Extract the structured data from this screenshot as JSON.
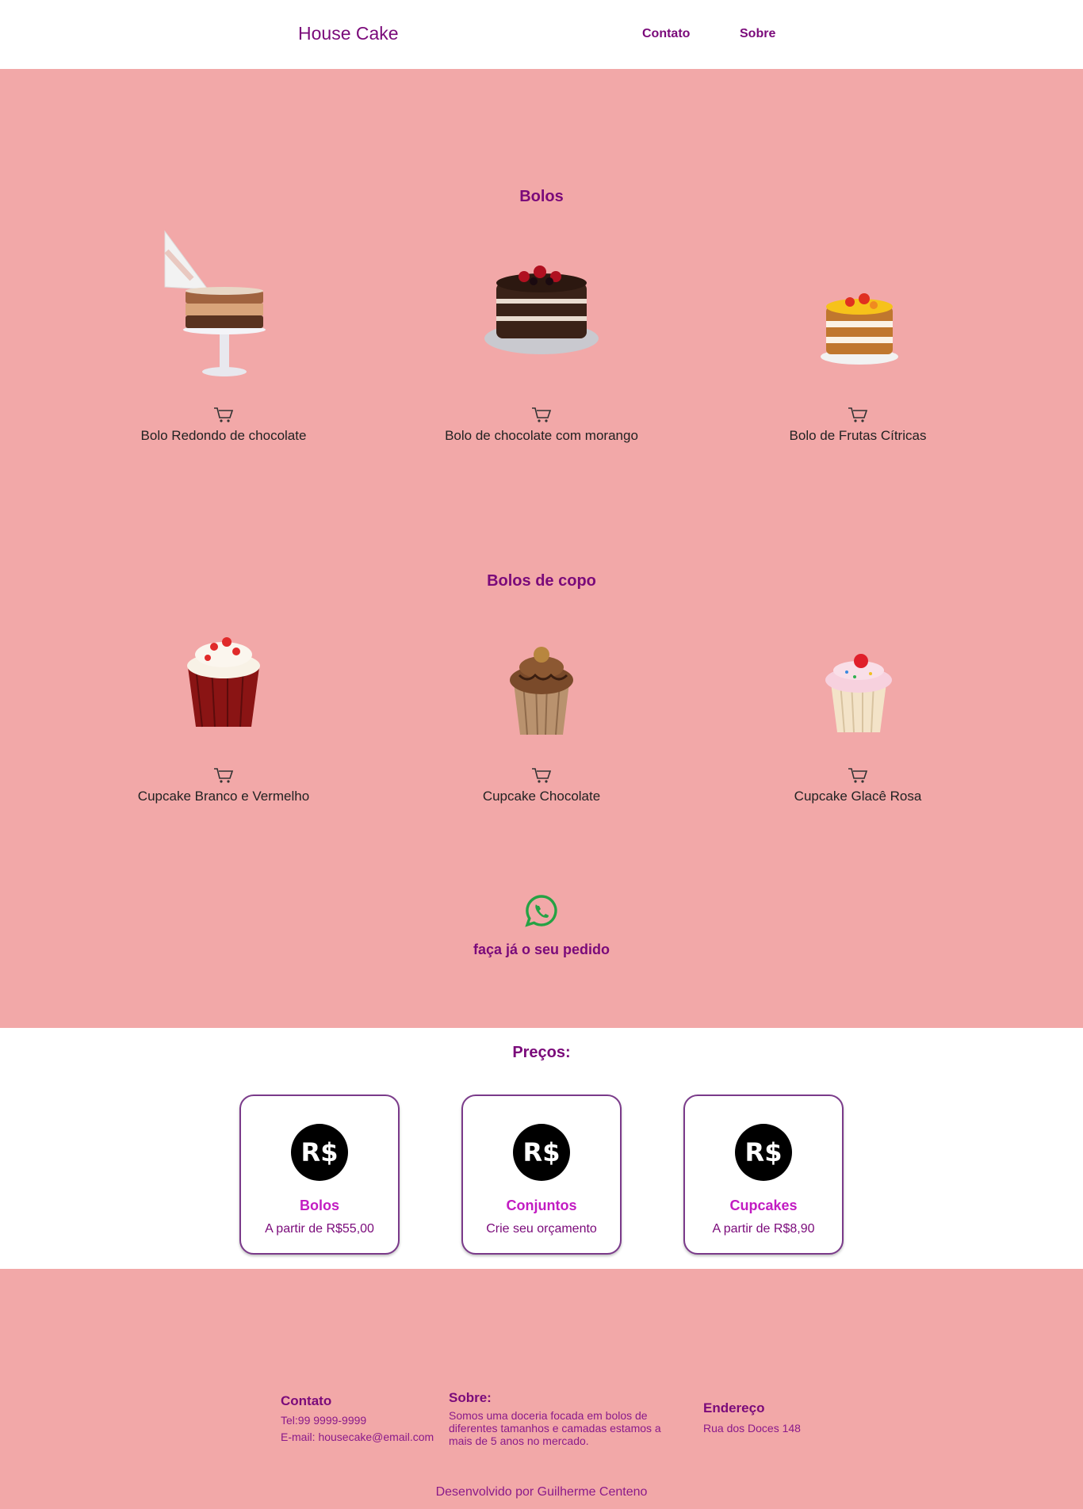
{
  "header": {
    "brand": "House Cake",
    "nav": [
      "Contato",
      "Sobre"
    ]
  },
  "sections": {
    "bolos": {
      "title": "Bolos",
      "items": [
        {
          "name": "Bolo Redondo de chocolate",
          "image": "cake-piping-chocolate-image"
        },
        {
          "name": "Bolo de chocolate com morango",
          "image": "chocolate-strawberry-cake-image"
        },
        {
          "name": "Bolo de Frutas Cítricas",
          "image": "citrus-fruit-cake-image"
        }
      ]
    },
    "bolos_de_copo": {
      "title": "Bolos de copo",
      "items": [
        {
          "name": "Cupcake Branco e Vermelho",
          "image": "red-velvet-cupcake-image"
        },
        {
          "name": "Cupcake Chocolate",
          "image": "chocolate-cupcake-image"
        },
        {
          "name": "Cupcake Glacê Rosa",
          "image": "pink-frosting-cupcake-image"
        }
      ]
    }
  },
  "cta": {
    "text": "faça já o seu pedido",
    "icon": "whatsapp-icon"
  },
  "prices": {
    "title": "Preços:",
    "icon_text": "R$",
    "cards": [
      {
        "name": "Bolos",
        "desc": "A partir de R$55,00"
      },
      {
        "name": "Conjuntos",
        "desc": "Crie seu orçamento"
      },
      {
        "name": "Cupcakes",
        "desc": "A partir de R$8,90"
      }
    ]
  },
  "footer": {
    "contato": {
      "title": "Contato",
      "tel": "Tel:99 9999-9999",
      "email": "E-mail: housecake@email.com"
    },
    "sobre": {
      "title": "Sobre:",
      "lines": [
        "Somos uma doceria focada em bolos de",
        "diferentes tamanhos e camadas estamos a",
        "mais de 5 anos no mercado."
      ]
    },
    "endereco": {
      "title": "Endereço",
      "address": "Rua dos Doces 148"
    },
    "credit": "Desenvolvido por Guilherme Centeno"
  },
  "colors": {
    "brand_purple": "#7a0a7a",
    "price_name_magenta": "#c21cc2",
    "pink_background": "#f2a8a8",
    "whatsapp_green": "#25a244"
  }
}
